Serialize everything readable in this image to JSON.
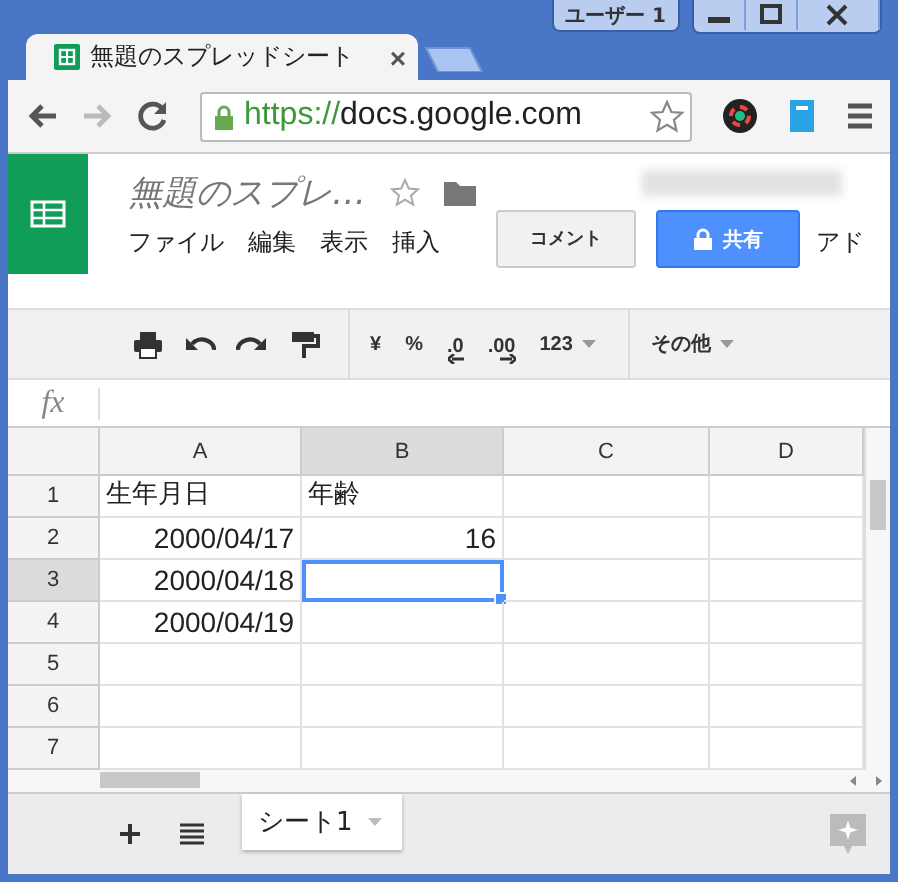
{
  "browser": {
    "profile": "ユーザー 1",
    "tab": {
      "title": "無題のスプレッドシート",
      "close": "×"
    },
    "url": {
      "scheme": "https://",
      "host": "docs.google.com"
    },
    "forward_disabled": true
  },
  "document": {
    "title": "無題のスプレ…",
    "menu": [
      "ファイル",
      "編集",
      "表示",
      "挿入",
      "アド"
    ],
    "comment_button": "コメント",
    "share_button": "共有"
  },
  "toolbar": [
    {
      "kind": "print"
    },
    {
      "kind": "undo"
    },
    {
      "kind": "redo"
    },
    {
      "kind": "paint"
    },
    {
      "kind": "sep"
    },
    {
      "kind": "text",
      "label": "¥"
    },
    {
      "kind": "text",
      "label": "%"
    },
    {
      "kind": "decrease",
      "label": ".0"
    },
    {
      "kind": "increase",
      "label": ".00"
    },
    {
      "kind": "dropdown",
      "label": "123"
    },
    {
      "kind": "sep"
    },
    {
      "kind": "more",
      "label": "その他"
    }
  ],
  "formula_bar": {
    "label": "fx"
  },
  "grid": {
    "columns": [
      {
        "label": "A",
        "selected": false
      },
      {
        "label": "B",
        "selected": true
      },
      {
        "label": "C",
        "selected": false
      },
      {
        "label": "D",
        "selected": false
      }
    ],
    "rows": [
      {
        "label": "1",
        "selected": false,
        "cells": [
          {
            "text": "生年月日",
            "kind": "text",
            "selected": false
          },
          {
            "text": "年齢",
            "kind": "text",
            "selected": false
          },
          {
            "selected": false
          },
          {
            "selected": false
          }
        ]
      },
      {
        "label": "2",
        "selected": false,
        "cells": [
          {
            "text": "2000/04/17",
            "kind": "number",
            "selected": false
          },
          {
            "text": "16",
            "kind": "number",
            "selected": false
          },
          {
            "selected": false
          },
          {
            "selected": false
          }
        ]
      },
      {
        "label": "3",
        "selected": true,
        "cells": [
          {
            "text": "2000/04/18",
            "kind": "number",
            "selected": false
          },
          {
            "selected": true
          },
          {
            "selected": false
          },
          {
            "selected": false
          }
        ]
      },
      {
        "label": "4",
        "selected": false,
        "cells": [
          {
            "text": "2000/04/19",
            "kind": "number",
            "selected": false
          },
          {
            "selected": false
          },
          {
            "selected": false
          },
          {
            "selected": false
          }
        ]
      },
      {
        "label": "5",
        "selected": false,
        "cells": [
          {
            "selected": false
          },
          {
            "selected": false
          },
          {
            "selected": false
          },
          {
            "selected": false
          }
        ]
      },
      {
        "label": "6",
        "selected": false,
        "cells": [
          {
            "selected": false
          },
          {
            "selected": false
          },
          {
            "selected": false
          },
          {
            "selected": false
          }
        ]
      },
      {
        "label": "7",
        "selected": false,
        "cells": [
          {
            "selected": false
          },
          {
            "selected": false
          },
          {
            "selected": false
          },
          {
            "selected": false
          }
        ]
      }
    ]
  },
  "sheets": [
    {
      "label": "シート1",
      "selected": true
    }
  ]
}
